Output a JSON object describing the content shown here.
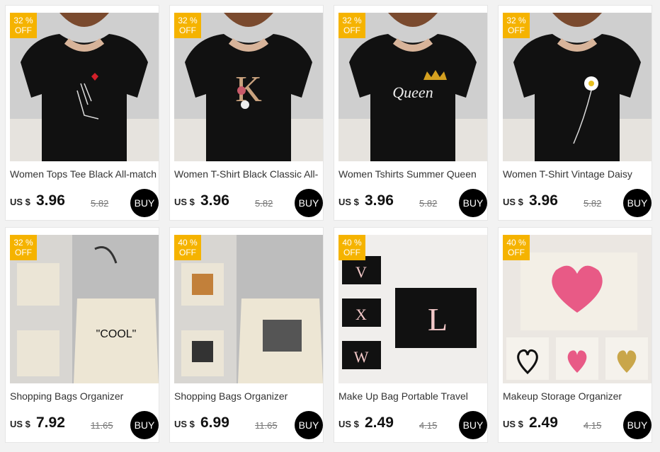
{
  "products": [
    {
      "title": "Women Tops Tee Black All-match",
      "currency": "US $",
      "price": "3.96",
      "old_price": "5.82",
      "discount_pct": "32 %",
      "discount_off": "OFF",
      "buy_label": "BUY"
    },
    {
      "title": "Women T-Shirt Black Classic All-",
      "currency": "US $",
      "price": "3.96",
      "old_price": "5.82",
      "discount_pct": "32 %",
      "discount_off": "OFF",
      "buy_label": "BUY"
    },
    {
      "title": "Women Tshirts Summer Queen",
      "currency": "US $",
      "price": "3.96",
      "old_price": "5.82",
      "discount_pct": "32 %",
      "discount_off": "OFF",
      "buy_label": "BUY"
    },
    {
      "title": "Women T-Shirt Vintage Daisy",
      "currency": "US $",
      "price": "3.96",
      "old_price": "5.82",
      "discount_pct": "32 %",
      "discount_off": "OFF",
      "buy_label": "BUY"
    },
    {
      "title": "Shopping Bags Organizer",
      "currency": "US $",
      "price": "7.92",
      "old_price": "11.65",
      "discount_pct": "32 %",
      "discount_off": "OFF",
      "buy_label": "BUY"
    },
    {
      "title": "Shopping Bags Organizer",
      "currency": "US $",
      "price": "6.99",
      "old_price": "11.65",
      "discount_pct": "40 %",
      "discount_off": "OFF",
      "buy_label": "BUY"
    },
    {
      "title": "Make Up Bag Portable Travel",
      "currency": "US $",
      "price": "2.49",
      "old_price": "4.15",
      "discount_pct": "40 %",
      "discount_off": "OFF",
      "buy_label": "BUY"
    },
    {
      "title": "Makeup Storage Organizer",
      "currency": "US $",
      "price": "2.49",
      "old_price": "4.15",
      "discount_pct": "40 %",
      "discount_off": "OFF",
      "buy_label": "BUY"
    }
  ],
  "image_text": {
    "shirt2_letter": "K",
    "shirt3_word": "Queen",
    "bag1_word": "\"COOL\"",
    "pouch_letters": [
      "V",
      "X",
      "W",
      "L"
    ]
  },
  "colors": {
    "badge": "#f5b300",
    "buy_button": "#000000",
    "card_bg": "#ffffff",
    "page_bg": "#f2f2f2"
  }
}
